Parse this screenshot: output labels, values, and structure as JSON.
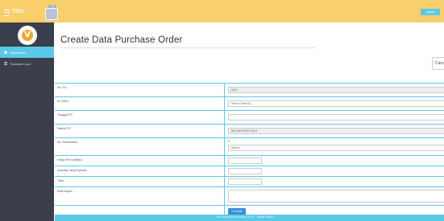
{
  "topbar": {
    "brand": "TSU",
    "chip_badge": "10",
    "logout_label": "Logout"
  },
  "sidebar": {
    "items": [
      {
        "label": "Dashboard",
        "active": true
      },
      {
        "label": "Transaksi Jual",
        "active": false
      }
    ]
  },
  "main": {
    "title": "Create Data Purchase Order",
    "cancel_label": "Cancel"
  },
  "form": {
    "no_po": {
      "label": "No. PO",
      "value": "0602"
    },
    "id_client": {
      "label": "ID Client",
      "value": "Select Client ID..."
    },
    "tanggal_po": {
      "label": "Tanggal PO",
      "value": ""
    },
    "status_po": {
      "label": "Status PO",
      "value": "BELUM DISETUJUI"
    },
    "no_penawaran": {
      "label": "No. Penawaran",
      "hint": "0",
      "value": "Select..."
    },
    "harga_per_unit": {
      "label": "Harga Per Unit(Rp)",
      "value": ""
    },
    "quantity": {
      "label": "Quantity Yang Dipesan",
      "value": ""
    },
    "total": {
      "label": "Total",
      "value": ""
    },
    "keterangan": {
      "label": "Keterangan",
      "value": ""
    },
    "create_label": "Create"
  },
  "footer": {
    "text": "Tsu Indonesia Inventory 2019 · Teknik Elektro"
  },
  "colors": {
    "accent": "#5bc8e8",
    "topbar": "#f8cf6b",
    "sidebar": "#3a3f4b",
    "button": "#3a8fd3"
  }
}
